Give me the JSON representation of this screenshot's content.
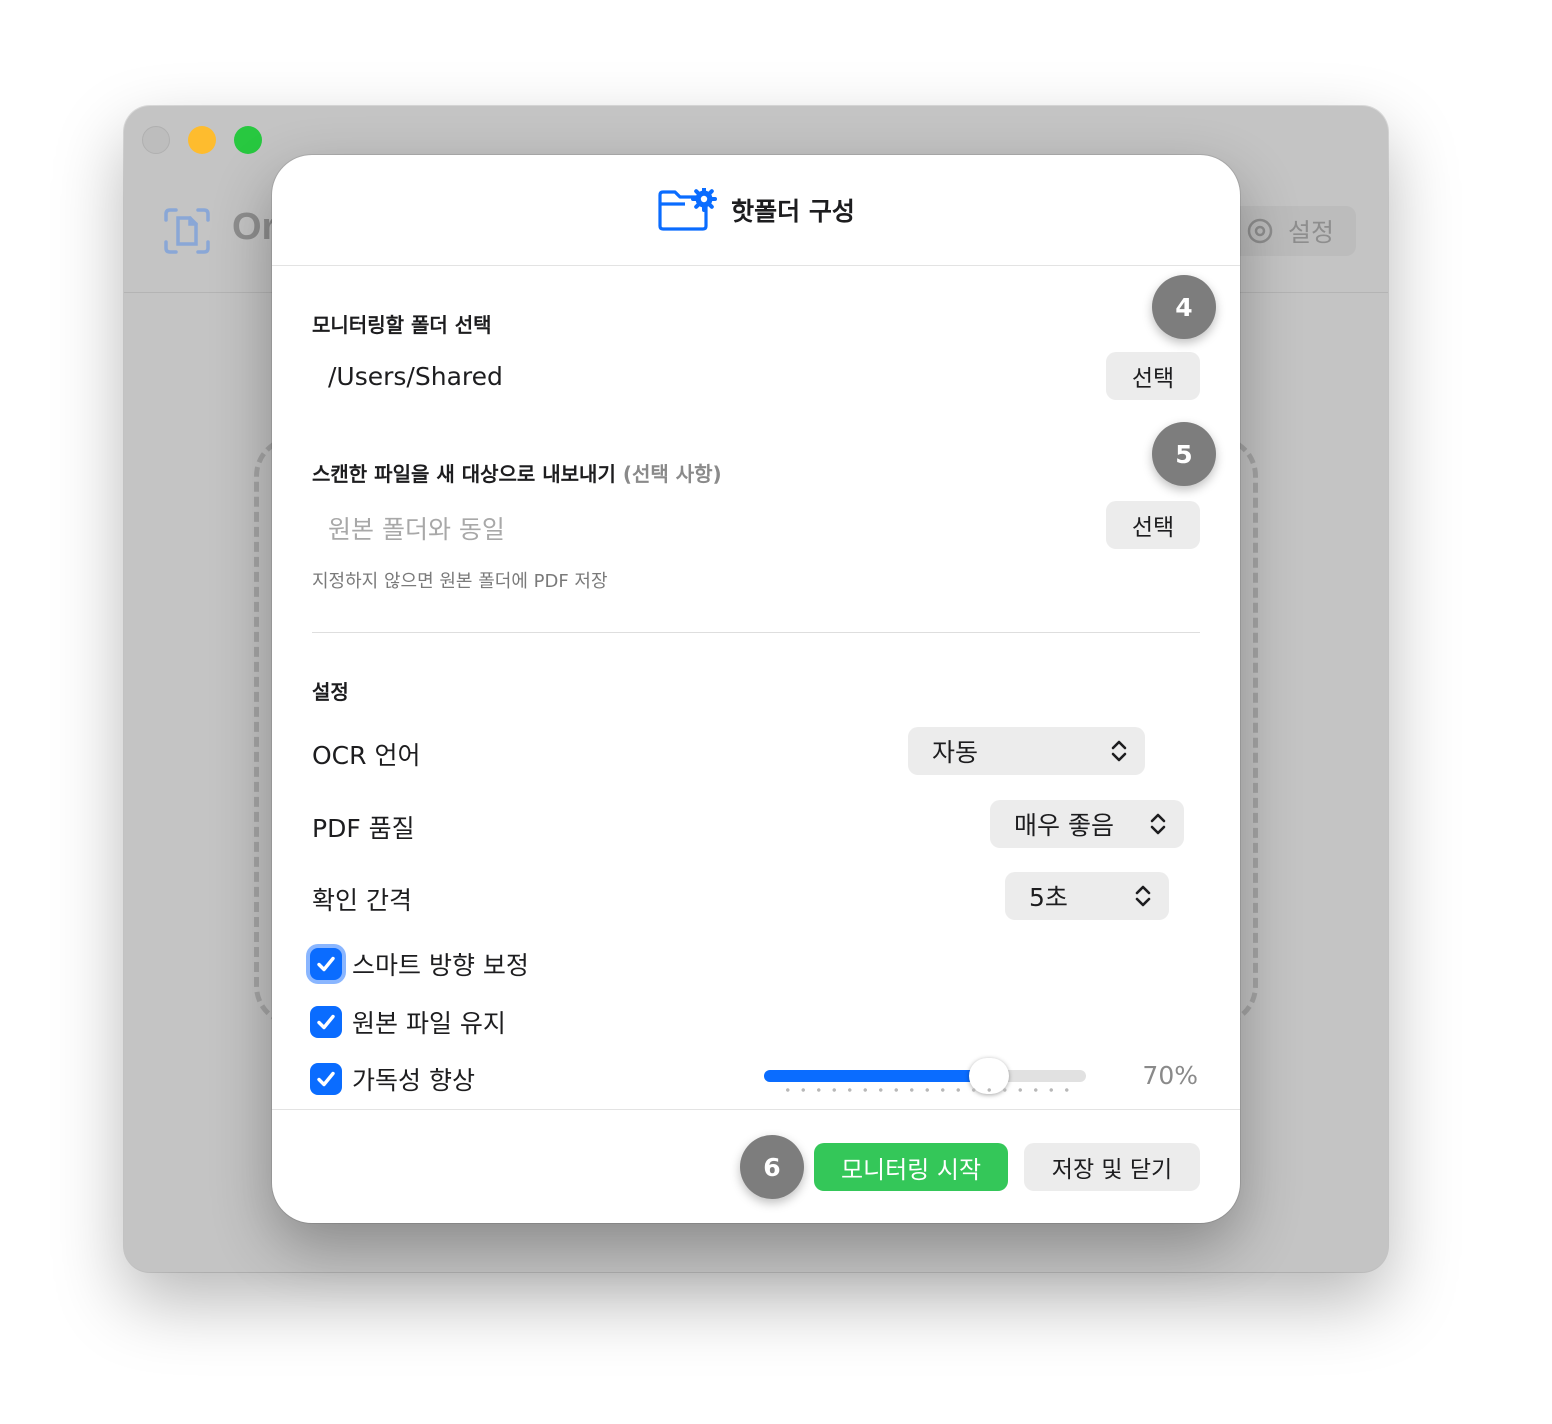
{
  "background_window": {
    "app_title": "Or",
    "settings_label": "설정"
  },
  "dialog": {
    "title": "핫폴더 구성",
    "monitor_section": {
      "label": "모니터링할 폴더 선택",
      "path": "/Users/Shared",
      "choose_label": "선택",
      "step": "4"
    },
    "export_section": {
      "label": "스캔한 파일을 새 대상으로 내보내기",
      "optional": "(선택 사항)",
      "placeholder": "원본 폴더와 동일",
      "choose_label": "선택",
      "helper": "지정하지 않으면 원본 폴더에 PDF 저장",
      "step": "5"
    },
    "settings": {
      "label": "설정",
      "ocr_language": {
        "label": "OCR 언어",
        "value": "자동"
      },
      "pdf_quality": {
        "label": "PDF 품질",
        "value": "매우 좋음"
      },
      "check_interval": {
        "label": "확인 간격",
        "value": "5초"
      },
      "checkboxes": [
        {
          "label": "스마트 방향 보정",
          "checked": true
        },
        {
          "label": "원본 파일 유지",
          "checked": true
        },
        {
          "label": "가독성 향상",
          "checked": true
        }
      ],
      "readability": {
        "value_label": "70%",
        "value": 0.7
      }
    },
    "footer": {
      "step": "6",
      "start_label": "모니터링 시작",
      "save_close_label": "저장 및 닫기"
    }
  },
  "colors": {
    "accent": "#0a6cff",
    "primary_button": "#34c759",
    "step_badge": "#7d7d7d"
  }
}
